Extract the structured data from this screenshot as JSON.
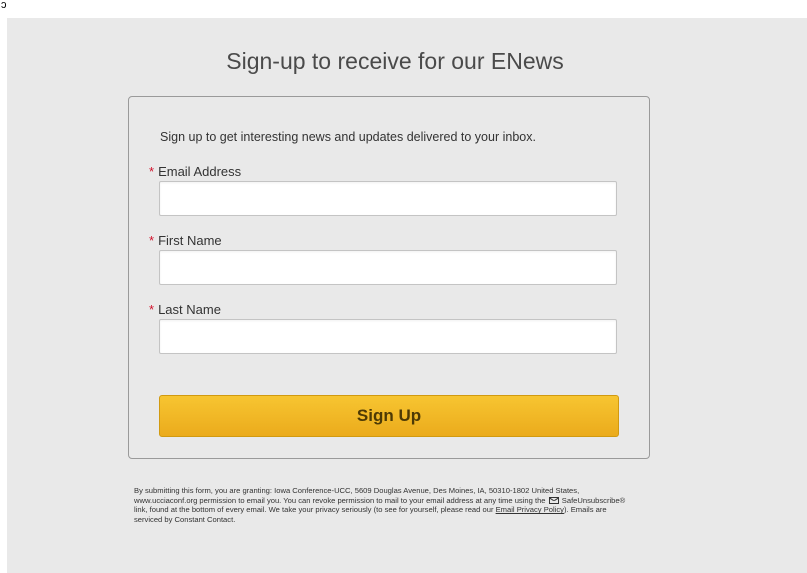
{
  "topbar": {
    "glyph": "ↄ"
  },
  "page": {
    "headline": "Sign-up to receive for our ENews"
  },
  "form": {
    "intro": "Sign up to get interesting news and updates delivered to your inbox.",
    "required_marker": "*",
    "fields": [
      {
        "label": "Email Address",
        "value": "",
        "placeholder": ""
      },
      {
        "label": "First Name",
        "value": "",
        "placeholder": ""
      },
      {
        "label": "Last Name",
        "value": "",
        "placeholder": ""
      }
    ],
    "submit_label": "Sign Up"
  },
  "legal": {
    "text_1": "By submitting this form, you are granting: Iowa Conference-UCC, 5609 Douglas Avenue, Des Moines, IA, 50310-1802 United States, www.ucciaconf.org permission to email you. You can revoke permission to mail to your email address at any time using the",
    "text_2": "SafeUnsubscribe® link, found at the bottom of every email. We take your privacy seriously (to see for yourself, please read our",
    "privacy_link": "Email Privacy Policy",
    "text_3": "). Emails are serviced by Constant Contact."
  },
  "colors": {
    "background": "#e9e9e9",
    "button": "#f0b624",
    "required": "#d0102a"
  }
}
